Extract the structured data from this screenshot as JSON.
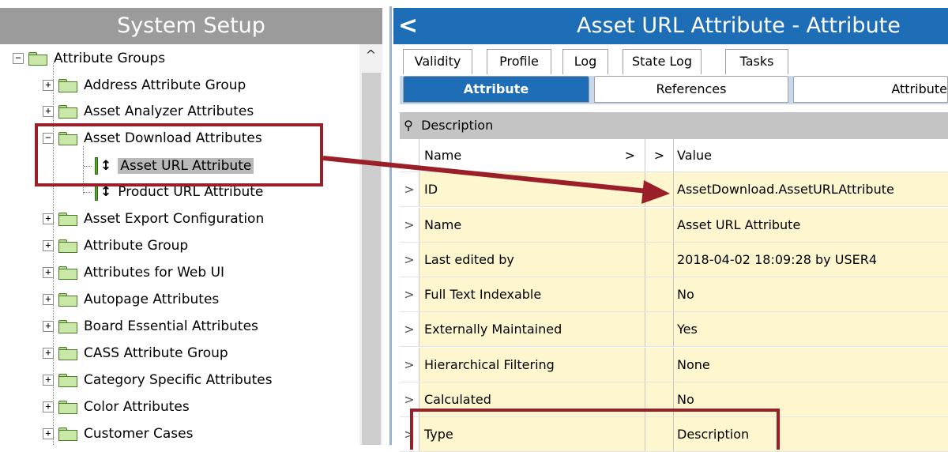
{
  "left_panel": {
    "title": "System Setup",
    "tree": [
      {
        "label": "Attribute Groups",
        "type": "folder",
        "expander": "−"
      },
      {
        "label": "Address Attribute Group",
        "type": "folder",
        "expander": "+"
      },
      {
        "label": "Asset Analyzer Attributes",
        "type": "folder",
        "expander": "+"
      },
      {
        "label": "Asset Download Attributes",
        "type": "folder",
        "expander": "−"
      },
      {
        "label": "Asset URL Attribute",
        "type": "attribute",
        "selected": true
      },
      {
        "label": "Product URL Attribute",
        "type": "attribute"
      },
      {
        "label": "Asset Export Configuration",
        "type": "folder",
        "expander": "+"
      },
      {
        "label": "Attribute Group",
        "type": "folder",
        "expander": "+"
      },
      {
        "label": "Attributes for Web UI",
        "type": "folder",
        "expander": "+"
      },
      {
        "label": "Autopage Attributes",
        "type": "folder",
        "expander": "+"
      },
      {
        "label": "Board Essential Attributes",
        "type": "folder",
        "expander": "+"
      },
      {
        "label": "CASS Attribute Group",
        "type": "folder",
        "expander": "+"
      },
      {
        "label": "Category Specific Attributes",
        "type": "folder",
        "expander": "+"
      },
      {
        "label": "Color Attributes",
        "type": "folder",
        "expander": "+"
      },
      {
        "label": "Customer Cases",
        "type": "folder",
        "expander": "+"
      }
    ],
    "scroll_up_glyph": "^"
  },
  "right_panel": {
    "back_glyph": "<",
    "title": "Asset URL Attribute - Attribute",
    "tabs_row1": [
      "Validity",
      "Profile",
      "Log",
      "State Log",
      "Tasks"
    ],
    "tabs_row2": [
      "Attribute",
      "References",
      "Attribute"
    ],
    "section": {
      "pin_glyph": "⚲",
      "label": "Description"
    },
    "grid_header": {
      "name": "Name",
      "arrow1": ">",
      "arrow2": ">",
      "value": "Value"
    },
    "rows": [
      {
        "expander": ">",
        "name": "ID",
        "value": "AssetDownload.AssetURLAttribute"
      },
      {
        "expander": ">",
        "name": "Name",
        "value": "Asset URL Attribute"
      },
      {
        "expander": ">",
        "name": "Last edited by",
        "value": "2018-04-02 18:09:28 by USER4"
      },
      {
        "expander": ">",
        "name": "Full Text Indexable",
        "value": "No"
      },
      {
        "expander": ">",
        "name": "Externally Maintained",
        "value": "Yes"
      },
      {
        "expander": ">",
        "name": "Hierarchical Filtering",
        "value": "None"
      },
      {
        "expander": ">",
        "name": "Calculated",
        "value": "No"
      },
      {
        "expander": ">",
        "name": "Type",
        "value": "Description"
      }
    ]
  },
  "colors": {
    "left_header": "#9b9b9b",
    "right_header": "#1e6eb7",
    "grid_cell": "#fdf6cf",
    "annotation": "#9a1f28"
  }
}
